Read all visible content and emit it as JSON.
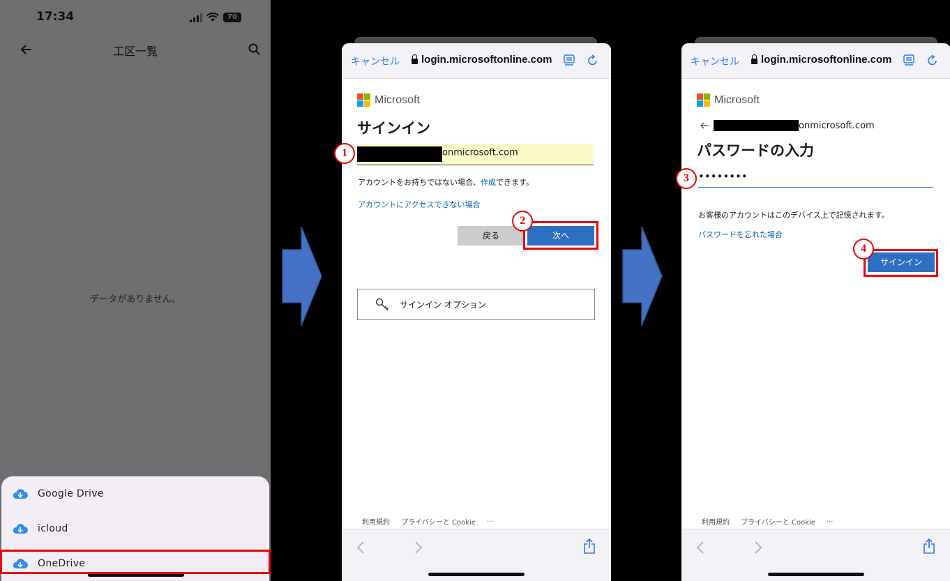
{
  "panel1": {
    "status_time": "17:34",
    "battery": "70",
    "title": "工区一覧",
    "empty_message": "データがありません。",
    "drives": [
      {
        "label": "Google Drive",
        "icon": "cloud-download-icon"
      },
      {
        "label": "icloud",
        "icon": "cloud-download-icon"
      },
      {
        "label": "OneDrive",
        "icon": "cloud-download-icon"
      }
    ]
  },
  "browser": {
    "cancel_label": "キャンセル",
    "url": "login.microsoftonline.com",
    "brand": "Microsoft",
    "footer_terms": "利用規約",
    "footer_privacy": "プライバシーと Cookie",
    "footer_more": "..."
  },
  "panel2": {
    "heading": "サインイン",
    "email_suffix": "onmicrosoft.com",
    "no_account_prefix": "アカウントをお持ちではない場合、",
    "create_link": "作成",
    "no_account_suffix": "できます。",
    "cant_access_link": "アカウントにアクセスできない場合",
    "back_button": "戻る",
    "next_button": "次へ",
    "signin_options": "サインイン オプション"
  },
  "panel3": {
    "email_suffix": "onmicrosoft.com",
    "heading": "パスワードの入力",
    "password_mask": "••••••••",
    "remember_note": "お客様のアカウントはこのデバイス上で記憶されます。",
    "forgot_link": "パスワードを忘れた場合",
    "signin_button": "サインイン"
  },
  "steps": [
    "1",
    "2",
    "3",
    "4"
  ],
  "colors": {
    "accent_blue": "#2f6fc1",
    "highlight_red": "#ee0000",
    "arrow_blue": "#4472c4",
    "ms_red": "#f25022",
    "ms_green": "#7fba00",
    "ms_blue": "#00a4ef",
    "ms_yellow": "#ffb900"
  }
}
